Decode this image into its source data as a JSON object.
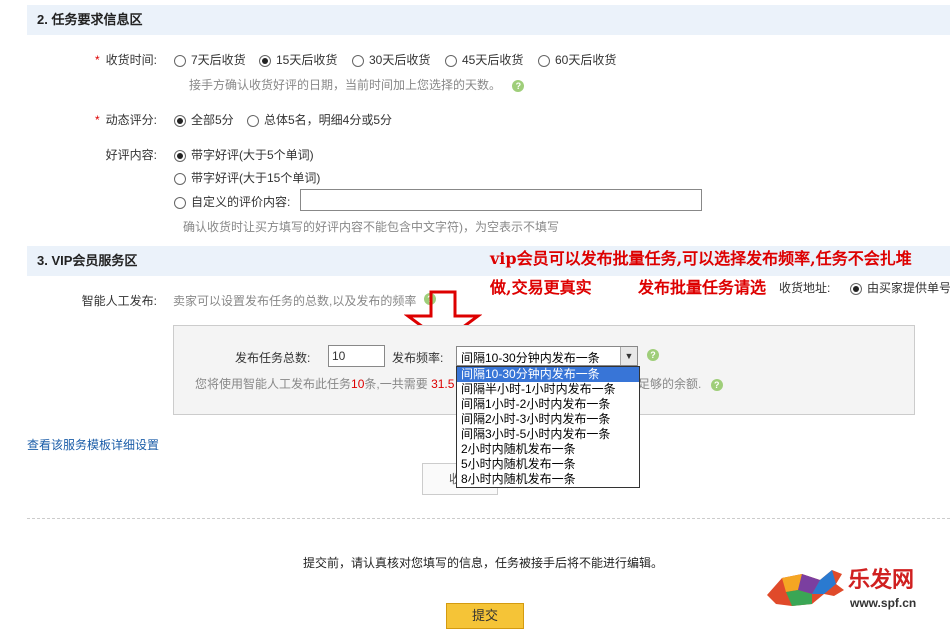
{
  "section2": {
    "title": "2. 任务要求信息区",
    "receive_time": {
      "required_mark": "*",
      "label": "收货时间:",
      "options": [
        "7天后收货",
        "15天后收货",
        "30天后收货",
        "45天后收货",
        "60天后收货"
      ],
      "selected": "15天后收货",
      "hint": "接手方确认收货好评的日期，当前时间加上您选择的天数。"
    },
    "rating": {
      "required_mark": "*",
      "label": "动态评分:",
      "options": [
        "全部5分",
        "总体5名，明细4分或5分"
      ],
      "selected": "全部5分"
    },
    "review": {
      "label": "好评内容:",
      "options": [
        "带字好评(大于5个单词)",
        "带字好评(大于15个单词)",
        "自定义的评价内容:"
      ],
      "selected": "带字好评(大于5个单词)",
      "custom_value": "",
      "hint": "确认收货时让买方填写的好评内容不能包含中文字符)，为空表示不填写"
    }
  },
  "section3": {
    "title": "3. VIP会员服务区",
    "smart_label": "智能人工发布:",
    "smart_hint": "卖家可以设置发布任务的总数,以及发布的频率",
    "total_label": "发布任务总数:",
    "total_value": "10",
    "freq_label": "发布频率:",
    "freq_selected": "间隔10-30分钟内发布一条",
    "freq_options": [
      "间隔10-30分钟内发布一条",
      "间隔半小时-1小时内发布一条",
      "间隔1小时-2小时内发布一条",
      "间隔2小时-3小时内发布一条",
      "间隔3小时-5小时内发布一条",
      "2小时内随机发布一条",
      "5小时内随机发布一条",
      "8小时内随机发布一条"
    ],
    "summary_prefix": "您将使用智能人工发布此任务",
    "summary_count": "10",
    "summary_mid": "条,一共需要",
    "summary_amount": "31.5",
    "summary_suffix": "足够的余额.",
    "template_link": "查看该服务模板详细设置",
    "partial_button": "收"
  },
  "annotations": {
    "line1": "vip会员可以发布批量任务,可以选择发布频率,任务不会扎堆",
    "line2": "做,交易更真实",
    "line3": "发布批量任务请选"
  },
  "address": {
    "label": "收货地址:",
    "option": "由买家提供单号"
  },
  "footer": {
    "notice": "提交前，请认真核对您填写的信息，任务被接手后将不能进行编辑。",
    "submit": "提交"
  },
  "watermark": {
    "brand": "乐发网",
    "url": "www.spf.cn"
  },
  "colors": {
    "section_bg": "#ebf2fa",
    "annotation": "#dd0000",
    "link": "#1a5ca8",
    "highlight": "#3875d7",
    "submit_bg": "#f5c437"
  }
}
